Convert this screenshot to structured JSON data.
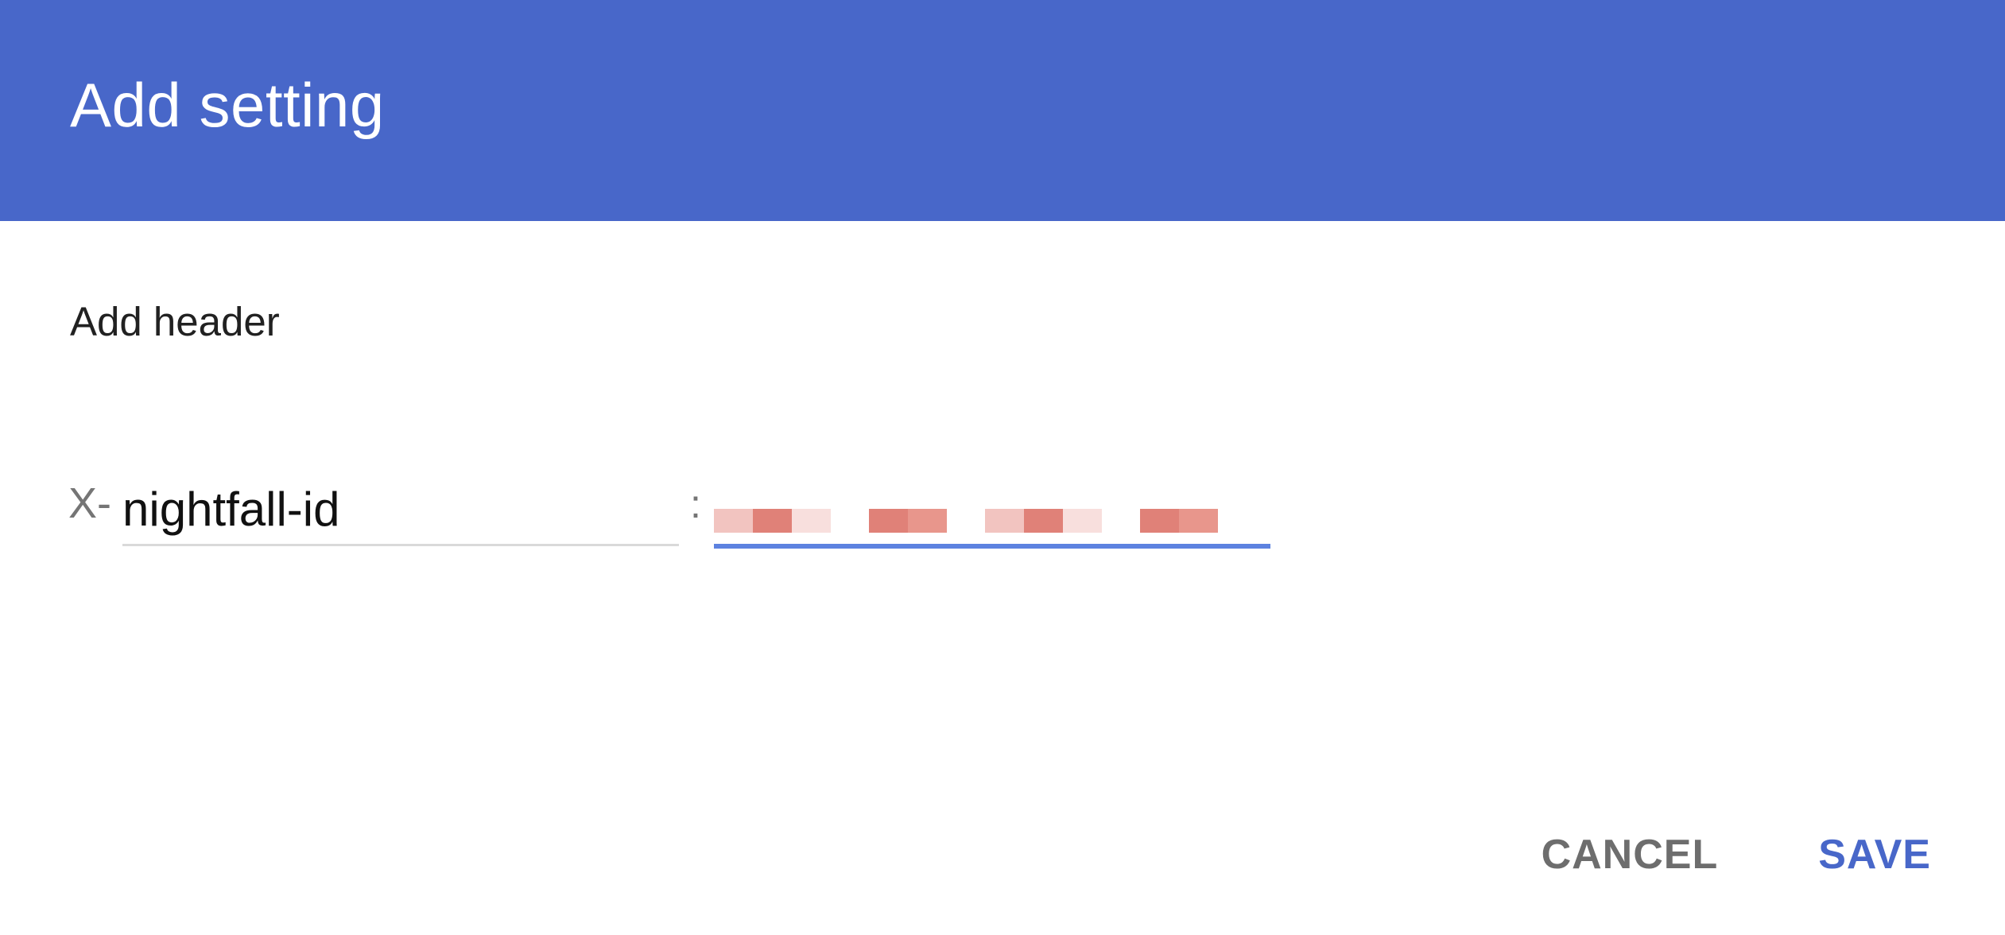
{
  "dialog": {
    "title": "Add setting",
    "section_label": "Add header"
  },
  "header_form": {
    "prefix": "X-",
    "name_value": "nightfall-id",
    "separator": ":",
    "value_redacted": true
  },
  "actions": {
    "cancel_label": "CANCEL",
    "save_label": "SAVE"
  },
  "colors": {
    "titlebar": "#4867c9",
    "accent": "#4867c9",
    "focused_underline": "#5d82e0",
    "redaction_light": "#f2c4c0",
    "redaction_dark": "#e08178"
  }
}
